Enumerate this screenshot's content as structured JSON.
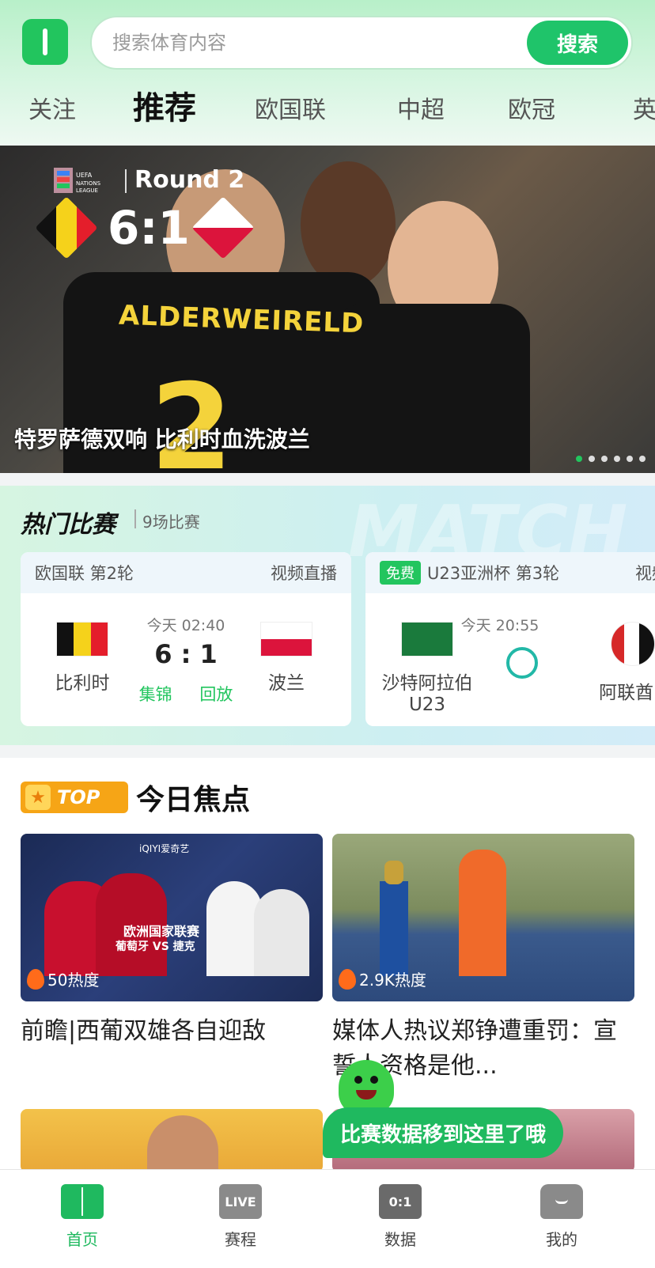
{
  "search": {
    "placeholder": "搜索体育内容",
    "button_label": "搜索"
  },
  "tabs": [
    "关注",
    "推荐",
    "欧国联",
    "中超",
    "欧冠",
    "英"
  ],
  "banner": {
    "league": "UEFA NATIONS LEAGUE",
    "round": "Round 2",
    "score": "6:1",
    "jersey_name": "ALDERWEIRELD",
    "jersey_number": "2",
    "caption": "特罗萨德双响 比利时血洗波兰",
    "dots_total": 6,
    "dots_active": 1
  },
  "hot_matches": {
    "title": "热门比赛",
    "count": "9场比赛",
    "watermark": "MATCH",
    "cards": [
      {
        "competition": "欧国联 第2轮",
        "stream": "视频直播",
        "home": "比利时",
        "away": "波兰",
        "time": "今天 02:40",
        "score": "6 : 1",
        "link1": "集锦",
        "link2": "回放"
      },
      {
        "free": "免费",
        "competition": "U23亚洲杯 第3轮",
        "stream": "视频直",
        "home": "沙特阿拉伯U23",
        "away": "阿联酋U",
        "time": "今天 20:55"
      }
    ]
  },
  "focus": {
    "badge": "TOP",
    "title": "今日焦点",
    "news": [
      {
        "heat": "50热度",
        "title": "前瞻|西葡双雄各自迎敌",
        "img_text": "欧洲国家联赛",
        "teams": "葡萄牙 VS 捷克",
        "brand": "iQIYI爱奇艺"
      },
      {
        "heat": "2.9K热度",
        "title": "媒体人热议郑铮遭重罚：宣誓人资格是他..."
      }
    ]
  },
  "toast": "比赛数据移到这里了哦",
  "bottom_nav": [
    {
      "label": "首页",
      "icon": "pitch-icon"
    },
    {
      "label": "赛程",
      "icon": "live-icon",
      "icon_text": "LIVE"
    },
    {
      "label": "数据",
      "icon": "scoreboard-icon",
      "icon_text": "0:1"
    },
    {
      "label": "我的",
      "icon": "shirt-icon"
    }
  ],
  "colors": {
    "accent": "#1fc46a",
    "top_badge": "#f6a516"
  }
}
